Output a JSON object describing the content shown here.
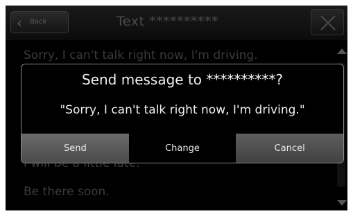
{
  "header": {
    "back_label": "Back",
    "title": "Text **********"
  },
  "messages": [
    "Sorry, I can't talk right now, I'm driving.",
    "I will be a little late.",
    "Be there soon."
  ],
  "dialog": {
    "title": "Send message to **********?",
    "body": "\"Sorry, I can't talk right now, I'm driving.\"",
    "buttons": {
      "send": "Send",
      "change": "Change",
      "cancel": "Cancel"
    }
  },
  "icons": {
    "back": "chevron-left-icon",
    "close": "close-icon",
    "scroll_up": "arrow-up-icon",
    "scroll_down": "arrow-down-icon"
  }
}
